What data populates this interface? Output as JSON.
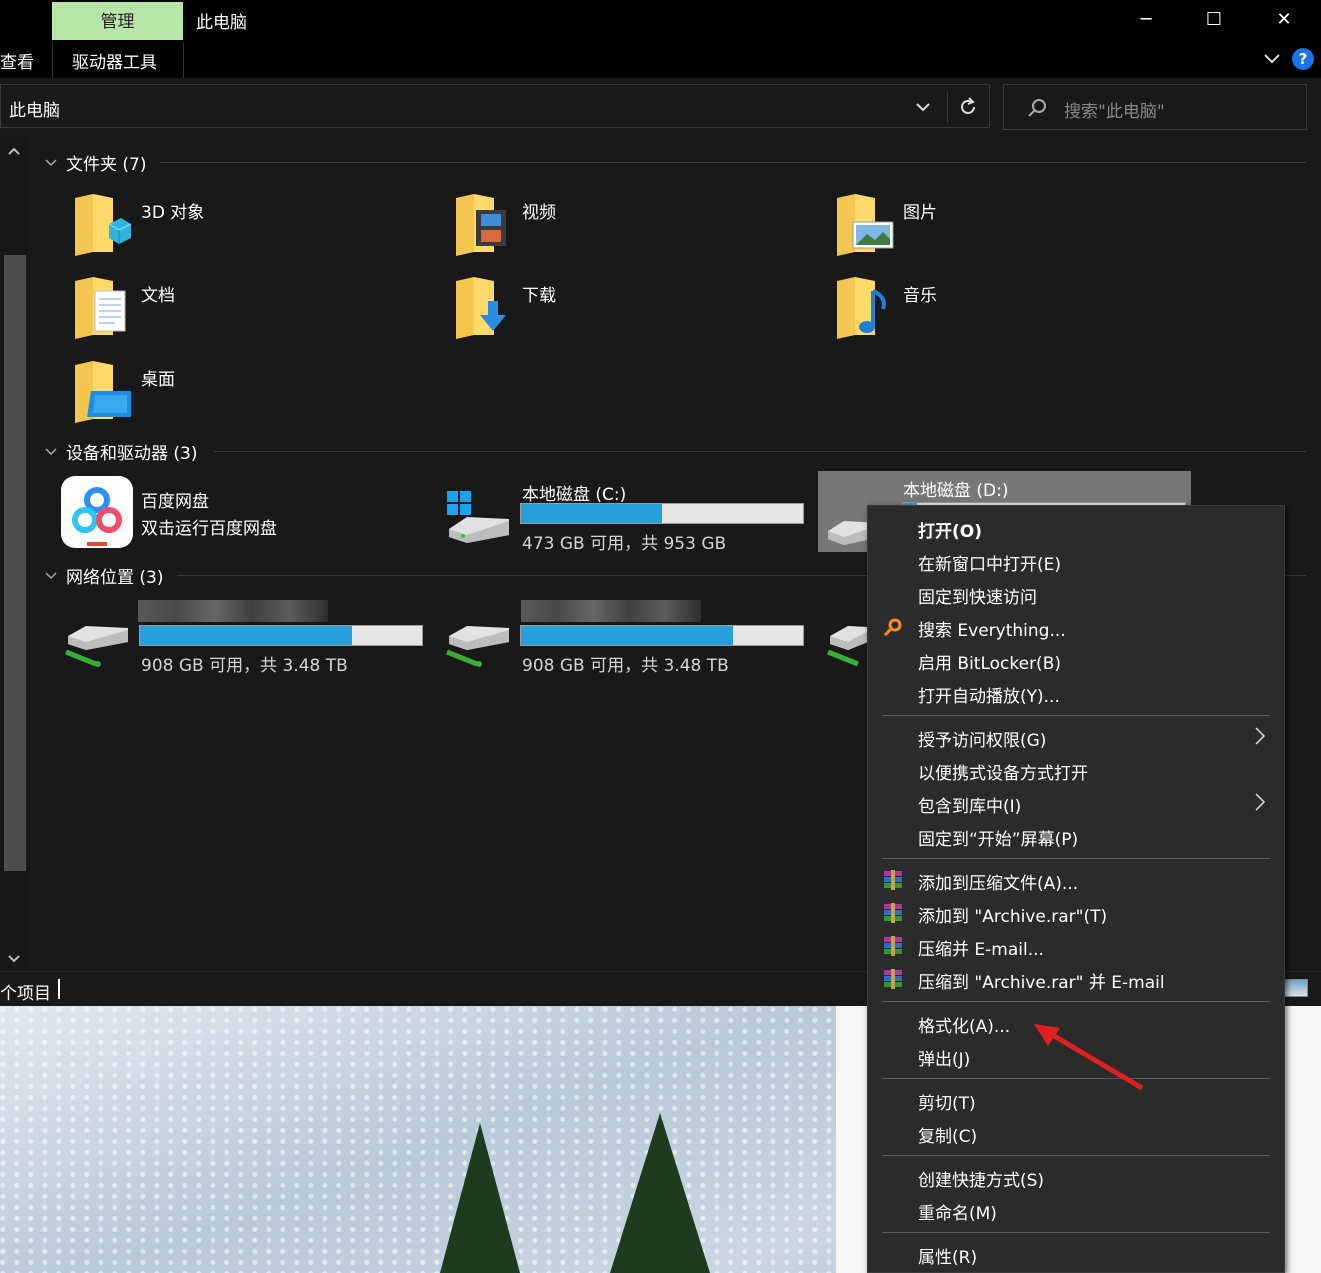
{
  "window": {
    "title": "此电脑",
    "manage_tab": "管理",
    "ribbon_view_tab": "查看",
    "ribbon_drive_tools_tab": "驱动器工具",
    "minimize": "─",
    "maximize": "☐",
    "close": "✕",
    "help": "?"
  },
  "address": {
    "path": "此电脑",
    "search_placeholder": "搜索\"此电脑\""
  },
  "groups": {
    "folders_header": "文件夹 (7)",
    "devices_header": "设备和驱动器 (3)",
    "network_header": "网络位置 (3)"
  },
  "folders": [
    {
      "label": "3D 对象",
      "icon": "3d-objects-folder-icon"
    },
    {
      "label": "视频",
      "icon": "videos-folder-icon"
    },
    {
      "label": "图片",
      "icon": "pictures-folder-icon"
    },
    {
      "label": "文档",
      "icon": "documents-folder-icon"
    },
    {
      "label": "下载",
      "icon": "downloads-folder-icon"
    },
    {
      "label": "音乐",
      "icon": "music-folder-icon"
    },
    {
      "label": "桌面",
      "icon": "desktop-folder-icon"
    }
  ],
  "devices": {
    "baidu": {
      "name": "百度网盘",
      "subtitle": "双击运行百度网盘"
    },
    "c_drive": {
      "name": "本地磁盘 (C:)",
      "space": "473 GB 可用，共 953 GB",
      "used_fraction": 0.5
    },
    "d_drive": {
      "name": "本地磁盘 (D:)",
      "used_fraction": 0.05
    }
  },
  "network": [
    {
      "space": "908 GB 可用，共 3.48 TB",
      "used_fraction": 0.75
    },
    {
      "space": "908 GB 可用，共 3.48 TB",
      "used_fraction": 0.75
    }
  ],
  "status": {
    "text": "个项目"
  },
  "context_menu": {
    "open": "打开(O)",
    "open_new_window": "在新窗口中打开(E)",
    "pin_quick_access": "固定到快速访问",
    "search_everything": "搜索 Everything...",
    "enable_bitlocker": "启用 BitLocker(B)",
    "open_autoplay": "打开自动播放(Y)...",
    "give_access": "授予访问权限(G)",
    "open_portable": "以便携式设备方式打开",
    "include_library": "包含到库中(I)",
    "pin_start": "固定到“开始”屏幕(P)",
    "add_archive": "添加到压缩文件(A)...",
    "add_archive_rar": "添加到 \"Archive.rar\"(T)",
    "compress_email": "压缩并 E-mail...",
    "compress_rar_email": "压缩到 \"Archive.rar\" 并 E-mail",
    "format": "格式化(A)...",
    "eject": "弹出(J)",
    "cut": "剪切(T)",
    "copy": "复制(C)",
    "create_shortcut": "创建快捷方式(S)",
    "rename": "重命名(M)",
    "properties": "属性(R)"
  },
  "colors": {
    "accent_bar": "#26a0da",
    "manage_tab_bg": "#b5e6a8",
    "annotation_arrow": "#e02020"
  }
}
